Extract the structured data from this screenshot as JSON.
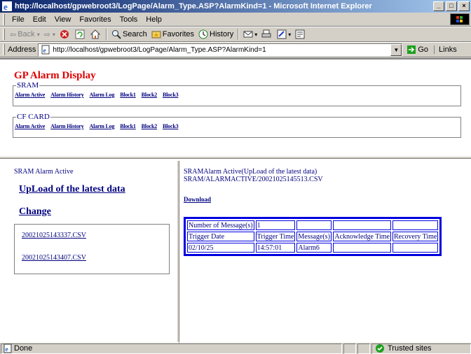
{
  "window": {
    "title": "http://localhost/gpwebroot3/LogPage/Alarm_Type.ASP?AlarmKind=1 - Microsoft Internet Explorer",
    "btn_minimize": "_",
    "btn_restore": "□",
    "btn_close": "×"
  },
  "menu": [
    "File",
    "Edit",
    "View",
    "Favorites",
    "Tools",
    "Help"
  ],
  "toolbar": {
    "back": "Back",
    "search": "Search",
    "favorites": "Favorites",
    "history": "History"
  },
  "address": {
    "label": "Address",
    "url": "http://localhost/gpwebroot3/LogPage/Alarm_Type.ASP?AlarmKind=1",
    "go": "Go",
    "links": "Links"
  },
  "top": {
    "title": "GP Alarm Display",
    "sram": {
      "legend": "SRAM",
      "links": [
        "Alarm Active",
        "Alarm History",
        "Alarm Log",
        "Block1",
        "Block2",
        "Block3"
      ]
    },
    "cfcard": {
      "legend": "CF CARD",
      "links": [
        "Alarm Active",
        "Alarm History",
        "Alarm Log",
        "Block1",
        "Block2",
        "Block3"
      ]
    }
  },
  "left": {
    "title": "SRAM Alarm Active",
    "upload": "UpLoad of the latest data",
    "change": "Change",
    "files": [
      "20021025143337.CSV",
      "20021025143407.CSV"
    ]
  },
  "right": {
    "title_line1": "SRAMAlarm Active(UpLoad of the latest data)",
    "title_line2": "SRAM/ALARMACTIVE/20021025145513.CSV",
    "download": "Download",
    "table": {
      "count_label": "Number of Message(s)",
      "count_value": "1",
      "headers": [
        "Trigger Date",
        "Trigger Time",
        "Message(s)",
        "Acknowledge Time",
        "Recovery Time"
      ],
      "rows": [
        [
          "02/10/25",
          "14:57:01",
          "Alarm6",
          "",
          ""
        ]
      ]
    }
  },
  "status": {
    "text": "Done",
    "zone": "Trusted sites"
  }
}
